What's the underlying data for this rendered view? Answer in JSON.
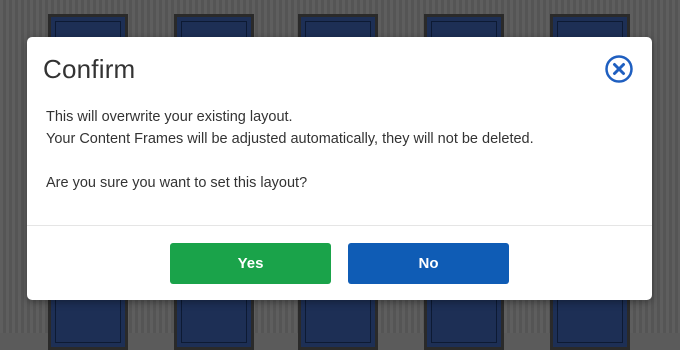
{
  "dialog": {
    "title": "Confirm",
    "message_line_1": "This will overwrite your existing layout.",
    "message_line_2": "Your Content Frames will be adjusted automatically, they will not be deleted.",
    "question": "Are you sure you want to set this layout?",
    "close_icon": "close-circle-icon",
    "yes_label": "Yes",
    "no_label": "No"
  },
  "colors": {
    "yes_button": "#1aa34a",
    "no_button": "#0f5cb5",
    "close_icon": "#1f5fc0",
    "thumbnail": "#1d2f55"
  }
}
